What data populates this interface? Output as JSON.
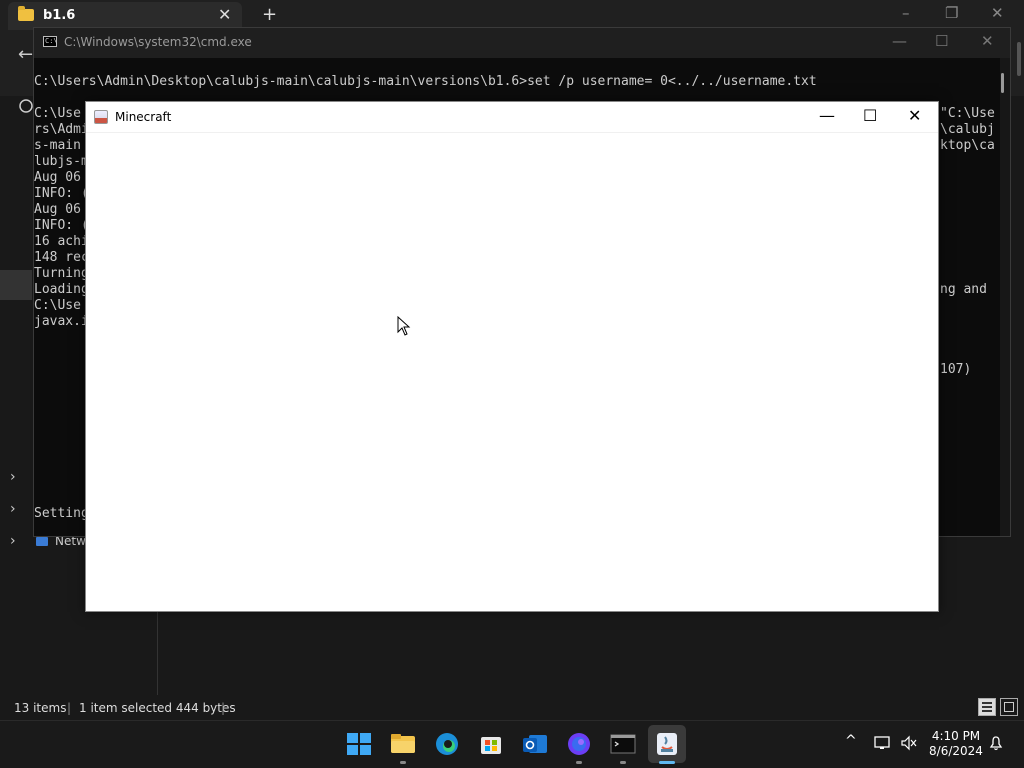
{
  "explorer": {
    "tab_title": "b1.6",
    "tab_close": "✕",
    "new_tab": "+",
    "minimize": "–",
    "maximize": "❐",
    "close": "✕",
    "back_arrow": "←",
    "sidebar_network_label": "Netw",
    "status": {
      "items_count": "13 items",
      "selection": "1 item selected  444 bytes"
    }
  },
  "cmd": {
    "title": "C:\\Windows\\system32\\cmd.exe",
    "minimize": "—",
    "maximize": "☐",
    "close": "✕",
    "icon_text": "C:\\",
    "command_line": "C:\\Users\\Admin\\Desktop\\calubjs-main\\calubjs-main\\versions\\b1.6>set /p username= 0<../../username.txt",
    "left_fragments": [
      "C:\\Use",
      "rs\\Admi",
      "s-main",
      "lubjs-m",
      "Aug 06",
      "INFO: (",
      "Aug 06",
      "INFO: (",
      "16 achi",
      "148 rec",
      "Turning",
      "Loading",
      "C:\\Use",
      "javax.i"
    ],
    "right_fragments": [
      "\"C:\\Use",
      "\\calubj",
      "ktop\\ca"
    ],
    "loading_suffix": "ng and",
    "line_ref": "107)",
    "setting_fragment": "Setting"
  },
  "minecraft": {
    "title": "Minecraft",
    "minimize": "—",
    "maximize": "☐",
    "close": "✕"
  },
  "taskbar": {
    "apps": [
      "start-icon",
      "file-explorer-icon",
      "edge-icon",
      "store-icon",
      "outlook-icon",
      "firefox-icon",
      "terminal-icon",
      "java-icon"
    ],
    "chevron": "^",
    "time": "4:10 PM",
    "date": "8/6/2024"
  }
}
